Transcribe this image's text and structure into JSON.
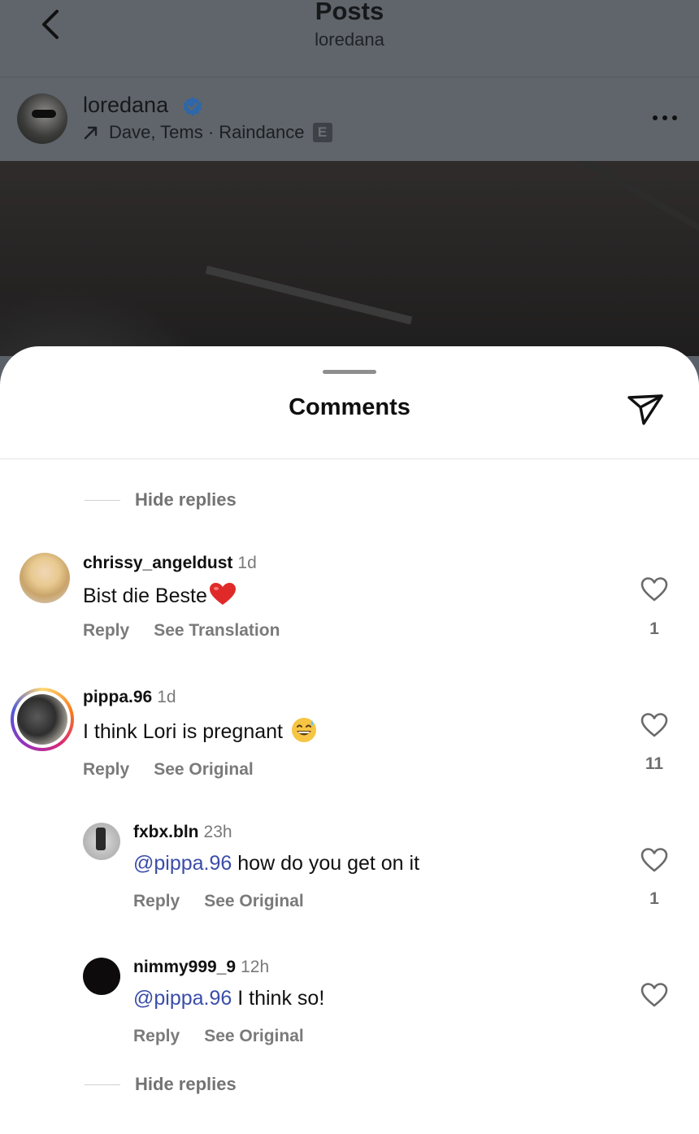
{
  "header": {
    "title": "Posts",
    "subtitle": "loredana",
    "back_icon": "chevron-left-icon"
  },
  "post": {
    "author": "loredana",
    "verified": true,
    "music": "Dave, Tems · Raindance",
    "explicit_badge": "E",
    "more_icon": "ellipsis-icon"
  },
  "comments_sheet": {
    "title": "Comments",
    "send_icon": "paper-plane-icon",
    "hide_replies_top": "Hide replies",
    "hide_replies_bottom": "Hide replies",
    "comments": [
      {
        "username": "chrissy_angeldust",
        "time": "1d",
        "text": "Bist die Beste",
        "reply_label": "Reply",
        "translate_label": "See Translation",
        "likes": "1"
      },
      {
        "username": "pippa.96",
        "time": "1d",
        "text": "I think Lori is pregnant",
        "reply_label": "Reply",
        "translate_label": "See Original",
        "likes": "11"
      },
      {
        "username": "fxbx.bln",
        "time": "23h",
        "mention": "@pippa.96",
        "text": "how do you get on it",
        "reply_label": "Reply",
        "translate_label": "See Original",
        "likes": "1"
      },
      {
        "username": "nimmy999_9",
        "time": "12h",
        "mention": "@pippa.96",
        "text": "I think so!",
        "reply_label": "Reply",
        "translate_label": "See Original",
        "likes": ""
      }
    ]
  },
  "colors": {
    "mention": "#3b4da8",
    "verified": "#3897f0",
    "story_ring": [
      "#feda75",
      "#fa7e1e",
      "#d62976",
      "#962fbf"
    ]
  }
}
